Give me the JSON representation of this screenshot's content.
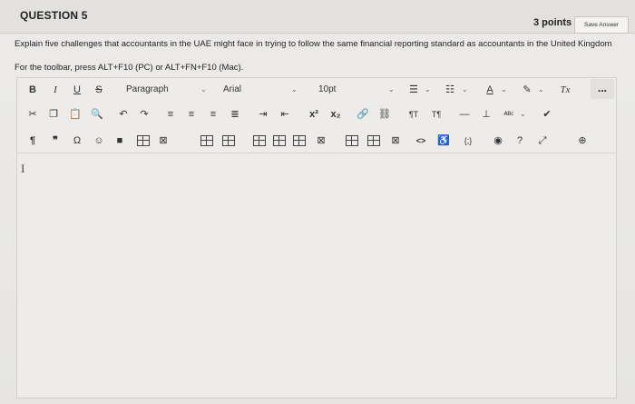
{
  "question": {
    "title": "QUESTION 5",
    "points": "3 points",
    "save_label": "Save Answer",
    "prompt": "Explain five challenges that accountants in the UAE might face in trying to follow the same financial reporting standard as accountants in the United Kingdom",
    "toolbar_note": "For the toolbar, press ALT+F10 (PC) or ALT+FN+F10 (Mac)."
  },
  "toolbar": {
    "row1": {
      "bold": "B",
      "italic": "I",
      "underline": "U",
      "strike": "S",
      "paragraph": "Paragraph",
      "font": "Arial",
      "size": "10pt",
      "text_color": "A",
      "clear_format": "Tx",
      "more": "..."
    },
    "row2": {
      "superscript": "x²",
      "subscript": "x₂",
      "ltr": "¶T",
      "rtl": "T¶"
    },
    "row3": {
      "paragraph_mark": "¶",
      "quote": "❞",
      "omega": "Ω",
      "code": "<>",
      "braces": "{;}"
    }
  },
  "icons": [
    "cut-icon",
    "copy-icon",
    "paste-icon",
    "search-icon",
    "undo-icon",
    "redo-icon",
    "align-left-icon",
    "align-center-icon",
    "align-right-icon",
    "justify-icon",
    "indent-icon",
    "outdent-icon",
    "link-icon",
    "unlink-icon",
    "hr-icon",
    "anchor-icon",
    "spellcheck-icon",
    "check-icon",
    "emoji-icon",
    "bookmark-icon",
    "table-icon",
    "image-icon",
    "accessibility-icon",
    "preview-icon",
    "help-icon",
    "fullscreen-icon",
    "add-icon"
  ]
}
